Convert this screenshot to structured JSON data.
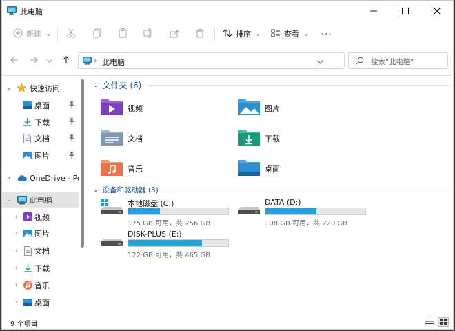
{
  "window": {
    "title": "此电脑"
  },
  "toolbar": {
    "new_label": "新建",
    "sort_label": "排序",
    "view_label": "查看",
    "more_label": "···"
  },
  "address": {
    "separator": "›",
    "location": "此电脑"
  },
  "search": {
    "placeholder": "搜索\"此电脑\""
  },
  "nav_pane": {
    "quick_access": "快速访问",
    "quick_items": [
      "桌面",
      "下载",
      "文档",
      "图片"
    ],
    "onedrive": "OneDrive - Pers",
    "this_pc": "此电脑",
    "pc_items": [
      "视频",
      "图片",
      "文档",
      "下载",
      "音乐",
      "桌面"
    ]
  },
  "content": {
    "folders_header": "文件夹 (6)",
    "folders": [
      "视频",
      "图片",
      "文档",
      "下载",
      "音乐",
      "桌面"
    ],
    "drives_header": "设备和驱动器 (3)",
    "drives": [
      {
        "name": "本地磁盘 (C:)",
        "space": "175 GB 可用，共 256 GB",
        "used_fraction": 0.32
      },
      {
        "name": "DATA (D:)",
        "space": "108 GB 可用，共 220 GB",
        "used_fraction": 0.51
      },
      {
        "name": "DISK-PLUS (E:)",
        "space": "122 GB 可用，共 465 GB",
        "used_fraction": 0.74
      }
    ]
  },
  "status": {
    "item_count": "9 个项目"
  },
  "colors": {
    "accent": "#26a0da",
    "header_blue": "#1a4d8f"
  }
}
